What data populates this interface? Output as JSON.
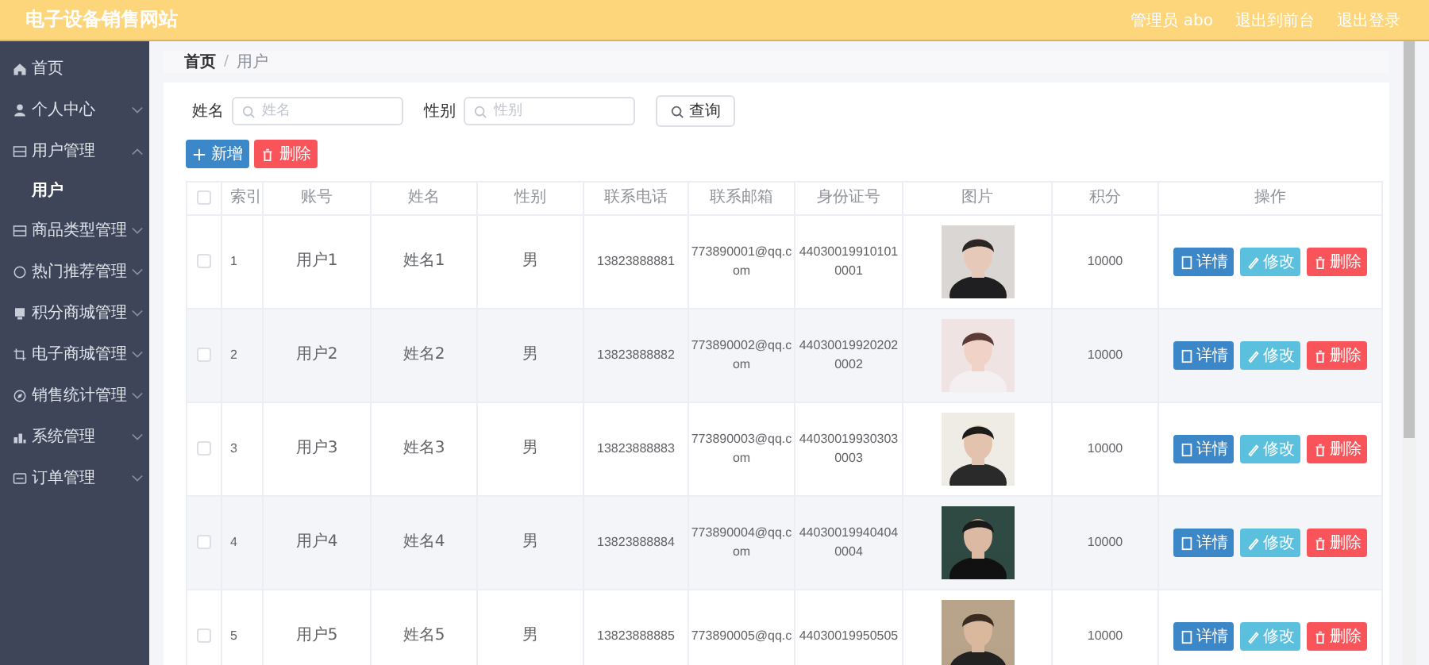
{
  "header": {
    "title": "电子设备销售网站",
    "links": [
      "管理员 abo",
      "退出到前台",
      "退出登录"
    ]
  },
  "sidebar": {
    "items": [
      {
        "label": "首页",
        "kind": "link"
      },
      {
        "label": "个人中心",
        "kind": "menu",
        "expanded": false
      },
      {
        "label": "用户管理",
        "kind": "menu",
        "expanded": true,
        "children": [
          {
            "label": "用户",
            "selected": true
          }
        ]
      },
      {
        "label": "商品类型管理",
        "kind": "menu",
        "expanded": false
      },
      {
        "label": "热门推荐管理",
        "kind": "menu",
        "expanded": false
      },
      {
        "label": "积分商城管理",
        "kind": "menu",
        "expanded": false
      },
      {
        "label": "电子商城管理",
        "kind": "menu",
        "expanded": false
      },
      {
        "label": "销售统计管理",
        "kind": "menu",
        "expanded": false
      },
      {
        "label": "系统管理",
        "kind": "menu",
        "expanded": false
      },
      {
        "label": "订单管理",
        "kind": "menu",
        "expanded": false
      }
    ]
  },
  "breadcrumb": {
    "separator": "/",
    "items": [
      {
        "label": "首页",
        "current": false
      },
      {
        "label": "用户",
        "current": true
      }
    ]
  },
  "search": {
    "fields": [
      {
        "label": "姓名",
        "placeholder": "姓名"
      },
      {
        "label": "性别",
        "placeholder": "性别"
      }
    ],
    "button": "查询"
  },
  "toolbar": [
    {
      "label": "新增",
      "kind": "add"
    },
    {
      "label": "删除",
      "kind": "delete"
    }
  ],
  "table": {
    "select_all": {
      "checked": false
    },
    "columns": [
      "索引",
      "账号",
      "姓名",
      "性别",
      "联系电话",
      "联系邮箱",
      "身份证号",
      "图片",
      "积分",
      "操作"
    ],
    "rows": [
      {
        "checked": false,
        "index": "1",
        "account": "用户1",
        "name": "姓名1",
        "gender": "男",
        "phone": "13823888881",
        "email": "773890001@qq.com",
        "id_number": "440300199101010001",
        "points": "10000",
        "actions": [
          {
            "label": "详情",
            "kind": "detail"
          },
          {
            "label": "修改",
            "kind": "edit"
          },
          {
            "label": "删除",
            "kind": "delete"
          }
        ]
      },
      {
        "checked": false,
        "index": "2",
        "account": "用户2",
        "name": "姓名2",
        "gender": "男",
        "phone": "13823888882",
        "email": "773890002@qq.com",
        "id_number": "440300199202020002",
        "points": "10000",
        "actions": [
          {
            "label": "详情",
            "kind": "detail"
          },
          {
            "label": "修改",
            "kind": "edit"
          },
          {
            "label": "删除",
            "kind": "delete"
          }
        ]
      },
      {
        "checked": false,
        "index": "3",
        "account": "用户3",
        "name": "姓名3",
        "gender": "男",
        "phone": "13823888883",
        "email": "773890003@qq.com",
        "id_number": "440300199303030003",
        "points": "10000",
        "actions": [
          {
            "label": "详情",
            "kind": "detail"
          },
          {
            "label": "修改",
            "kind": "edit"
          },
          {
            "label": "删除",
            "kind": "delete"
          }
        ]
      },
      {
        "checked": false,
        "index": "4",
        "account": "用户4",
        "name": "姓名4",
        "gender": "男",
        "phone": "13823888884",
        "email": "773890004@qq.com",
        "id_number": "440300199404040004",
        "points": "10000",
        "actions": [
          {
            "label": "详情",
            "kind": "detail"
          },
          {
            "label": "修改",
            "kind": "edit"
          },
          {
            "label": "删除",
            "kind": "delete"
          }
        ]
      },
      {
        "checked": false,
        "index": "5",
        "account": "用户5",
        "name": "姓名5",
        "gender": "男",
        "phone": "13823888885",
        "email": "773890005@qq.c",
        "id_number": "44030019950505",
        "points": "10000",
        "actions": [
          {
            "label": "详情",
            "kind": "detail"
          },
          {
            "label": "修改",
            "kind": "edit"
          },
          {
            "label": "删除",
            "kind": "delete"
          }
        ]
      }
    ]
  }
}
